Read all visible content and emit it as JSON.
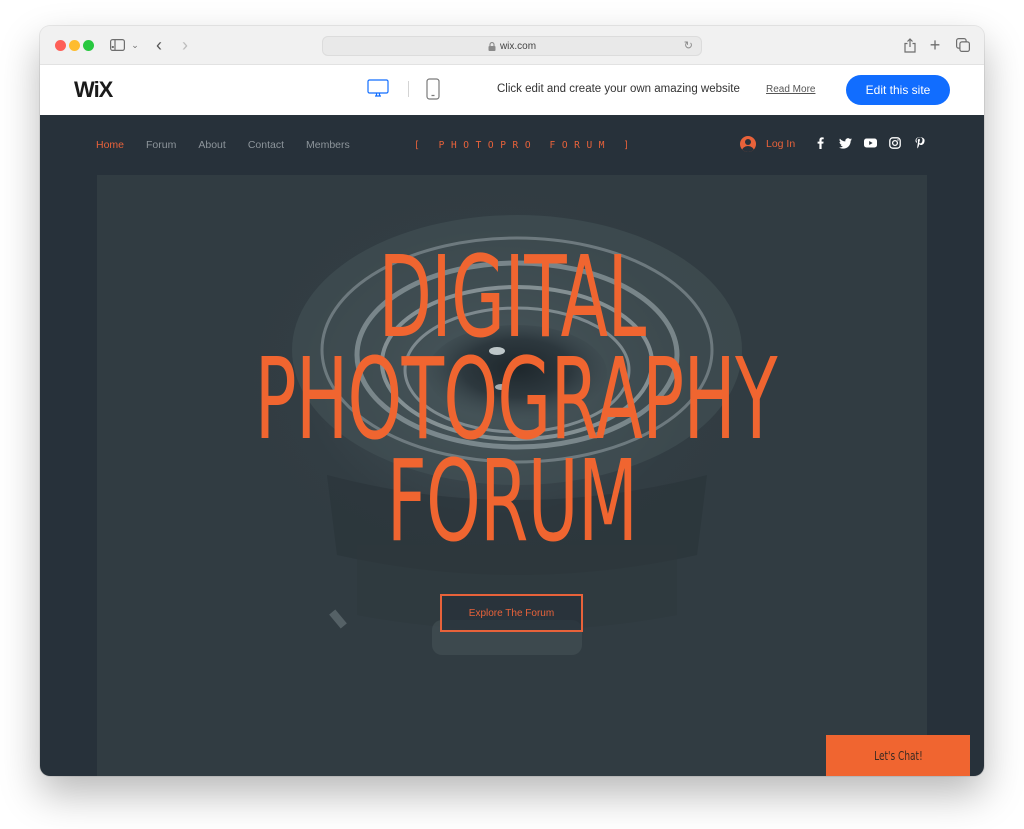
{
  "browser": {
    "url": "wix.com",
    "icons": [
      "sidebar-icon",
      "chevron-down-icon",
      "back-icon",
      "forward-icon",
      "lock-icon",
      "reload-icon",
      "share-icon",
      "new-tab-icon",
      "tab-overview-icon"
    ]
  },
  "wix_banner": {
    "logo": "WiX",
    "message": "Click edit and create your own amazing website",
    "read_more": "Read More",
    "edit_button": "Edit this site",
    "active_device": "desktop",
    "colors": {
      "button": "#116dff"
    }
  },
  "site": {
    "nav": [
      {
        "label": "Home",
        "active": true
      },
      {
        "label": "Forum",
        "active": false
      },
      {
        "label": "About",
        "active": false
      },
      {
        "label": "Contact",
        "active": false
      },
      {
        "label": "Members",
        "active": false
      }
    ],
    "brand": "[ PHOTOPRO FORUM ]",
    "login_label": "Log In",
    "social": [
      "facebook",
      "twitter",
      "youtube",
      "instagram",
      "pinterest"
    ],
    "hero": {
      "title_lines": [
        "DIGITAL",
        "PHOTOGRAPHY",
        "FORUM"
      ],
      "cta": "Explore The Forum"
    },
    "chat_button": "Let's Chat!",
    "colors": {
      "accent": "#f06530",
      "background": "#27313a",
      "nav_text": "#8d959b"
    }
  }
}
